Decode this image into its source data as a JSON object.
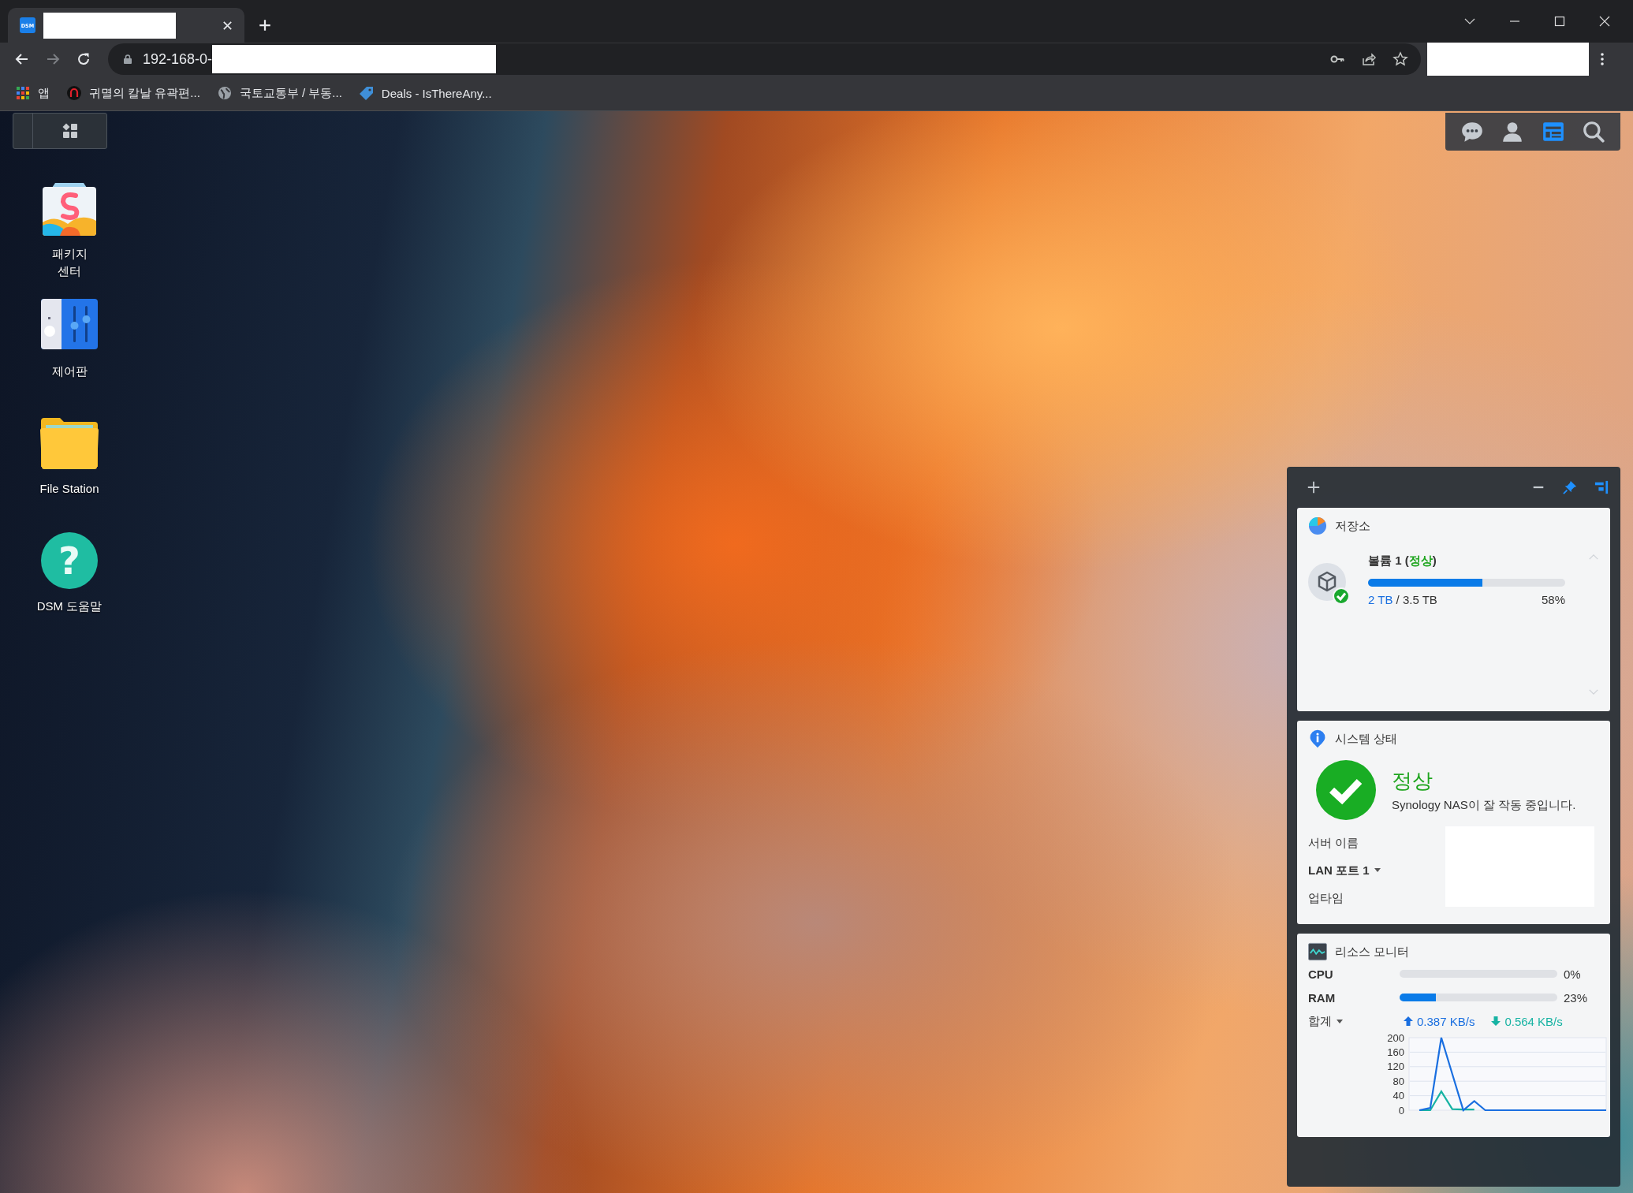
{
  "browser": {
    "tab": {
      "favicon_text": "DSM"
    },
    "address": "192-168-0-",
    "forward_disabled": true,
    "bookmarks": [
      {
        "kind": "apps",
        "label": "앱"
      },
      {
        "kind": "arch",
        "label": "귀멸의 칼날 유곽편..."
      },
      {
        "kind": "globe",
        "label": "국토교통부 / 부동..."
      },
      {
        "kind": "tag",
        "label": "Deals - IsThereAny..."
      }
    ]
  },
  "desktop": {
    "toolbar": [
      {
        "kind": "chat",
        "selected": false
      },
      {
        "kind": "user",
        "selected": false
      },
      {
        "kind": "widgets",
        "selected": true
      },
      {
        "kind": "search",
        "selected": false
      }
    ],
    "shortcuts": [
      {
        "kind": "package",
        "label": "패키지\n센터"
      },
      {
        "kind": "control",
        "label": "제어판"
      },
      {
        "kind": "folder",
        "label": "File Station"
      },
      {
        "kind": "help",
        "icon_text": "?",
        "label": "DSM 도움말"
      }
    ]
  },
  "widgets": {
    "storage": {
      "title": "저장소",
      "volumes": [
        {
          "name_before": "볼륨 1 (",
          "status": "정상",
          "name_after": ")",
          "level": 0.58,
          "used": "2 TB",
          "total": "/ 3.5 TB",
          "percent": "58%"
        }
      ]
    },
    "system": {
      "title": "시스템 상태",
      "status": "정상",
      "message": "Synology NAS이 잘 작동 중입니다.",
      "rows": [
        {
          "label": "서버 이름",
          "kind": "plain"
        },
        {
          "label": "LAN 포트 1",
          "kind": "dropdown"
        },
        {
          "label": "업타임",
          "kind": "plain"
        }
      ]
    },
    "resource": {
      "title": "리소스 모니터",
      "meters": [
        {
          "label": "CPU",
          "level": 0,
          "reading": "0%"
        },
        {
          "label": "RAM",
          "level": 0.23,
          "reading": "23%"
        }
      ],
      "total_label": "합계",
      "upload": "0.387 KB/s",
      "download": "0.564 KB/s",
      "chart_data": {
        "type": "line",
        "grid": true,
        "ylim": [
          0,
          200
        ],
        "yticks": [
          0,
          40,
          80,
          120,
          160,
          200
        ],
        "series": [
          {
            "color": "#1a6fe0",
            "values": [
              0,
              6,
              200,
              100,
              0,
              25,
              0,
              0,
              0,
              0,
              0,
              0,
              0,
              0,
              0,
              0,
              0,
              0
            ]
          },
          {
            "color": "#17b3a3",
            "values": [
              0,
              0,
              52,
              3,
              2,
              2,
              null,
              null,
              null,
              null,
              null,
              null,
              null,
              null,
              null,
              null,
              null,
              null
            ]
          }
        ]
      }
    }
  }
}
